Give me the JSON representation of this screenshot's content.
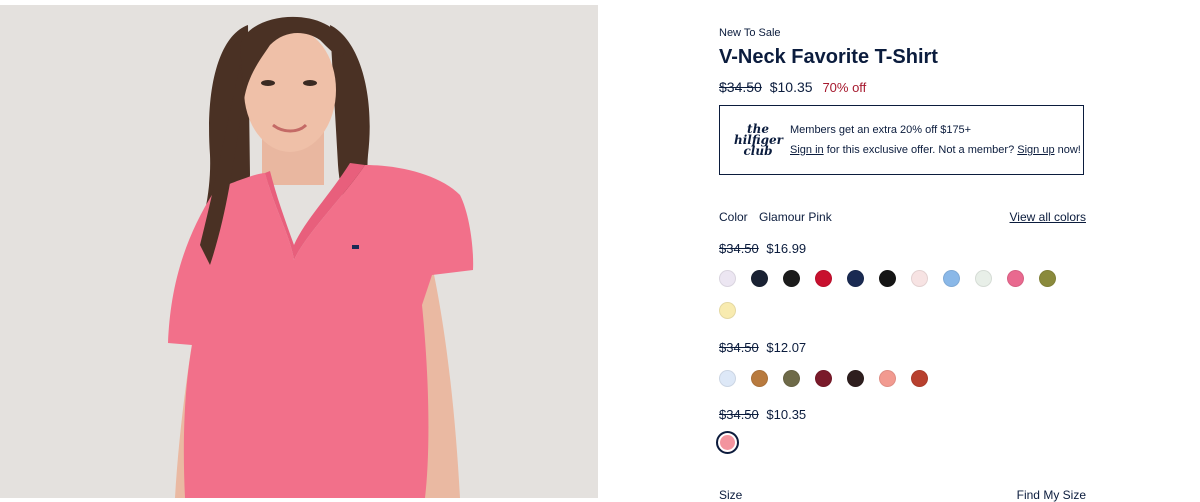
{
  "product": {
    "breadcrumb": "New To Sale",
    "title": "V-Neck Favorite T-Shirt",
    "original_price": "$34.50",
    "sale_price": "$10.35",
    "discount": "70% off"
  },
  "promo": {
    "logo_line1": "the",
    "logo_line2": "hilfiger",
    "logo_line3": "club",
    "line1": "Members get an extra 20% off $175+",
    "sign_in": "Sign in",
    "middle": " for this exclusive offer. Not a member? ",
    "sign_up": "Sign up",
    "end": " now!"
  },
  "color": {
    "label": "Color",
    "selected": "Glamour Pink",
    "view_all": "View all colors"
  },
  "groups": [
    {
      "original": "$34.50",
      "sale": "$16.99",
      "swatches": [
        "#ece6f2",
        "#1a2233",
        "#1c1c1c",
        "#c8102e",
        "#1a2a52",
        "#151515",
        "#f7e3e3",
        "#8ab8e8",
        "#e8efe8",
        "#e9698f",
        "#8a8a3c",
        "#f8ebb0"
      ]
    },
    {
      "original": "$34.50",
      "sale": "$12.07",
      "swatches": [
        "#dde8f7",
        "#b87a3e",
        "#6e6a48",
        "#7a1a2a",
        "#2e1e1e",
        "#f29a90",
        "#b8402e"
      ]
    },
    {
      "original": "$34.50",
      "sale": "$10.35",
      "swatches": [
        "#f3949e"
      ]
    }
  ],
  "size": {
    "label": "Size",
    "find": "Find My Size"
  }
}
